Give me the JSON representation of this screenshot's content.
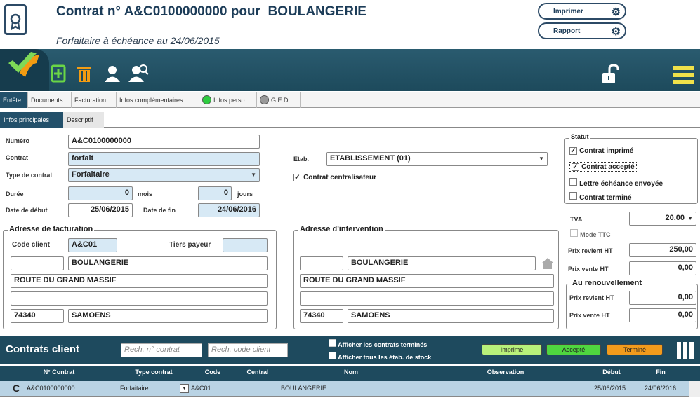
{
  "header": {
    "title_prefix": "Contrat n° A&C0100000000  pour",
    "title_client": "BOULANGERIE",
    "subtitle": "Forfaitaire à échéance au 24/06/2015",
    "print_label": "Imprimer",
    "report_label": "Rapport"
  },
  "tabs": [
    "Entête",
    "Documents",
    "Facturation",
    "Infos complémentaires",
    "Infos perso",
    "G.E.D."
  ],
  "subtabs": [
    "Infos principales",
    "Descriptif"
  ],
  "form": {
    "numero_label": "Numéro",
    "numero": "A&C0100000000",
    "contrat_label": "Contrat",
    "contrat": "forfait",
    "type_label": "Type de contrat",
    "type": "Forfaitaire",
    "duree_label": "Durée",
    "duree_mois": "0",
    "mois_label": "mois",
    "duree_jours": "0",
    "jours_label": "jours",
    "debut_label": "Date de début",
    "debut": "25/06/2015",
    "fin_label": "Date de fin",
    "fin": "24/06/2016",
    "etab_label": "Etab.",
    "etab": "ETABLISSEMENT (01)",
    "centralisateur_label": "Contrat centralisateur"
  },
  "statut": {
    "title": "Statut",
    "items": [
      {
        "label": "Contrat imprimé",
        "checked": "✓"
      },
      {
        "label": "Contrat accepté",
        "checked": "✓"
      },
      {
        "label": "Lettre échéance envoyée",
        "checked": ""
      },
      {
        "label": "Contrat terminé",
        "checked": ""
      }
    ]
  },
  "tarif": {
    "tva_label": "TVA",
    "tva": "20,00",
    "ttc_label": "Mode TTC",
    "prix_revient_label": "Prix revient HT",
    "prix_revient": "250,00",
    "prix_vente_label": "Prix vente HT",
    "prix_vente": "0,00",
    "renouv_title": "Au renouvellement",
    "renouv_revient_label": "Prix revient HT",
    "renouv_revient": "0,00",
    "renouv_vente_label": "Prix vente HT",
    "renouv_vente": "0,00"
  },
  "facturation": {
    "title": "Adresse de facturation",
    "code_label": "Code client",
    "code": "A&C01",
    "tiers_label": "Tiers payeur",
    "nom": "BOULANGERIE",
    "adresse": "ROUTE DU GRAND MASSIF",
    "cp": "74340",
    "ville": "SAMOENS"
  },
  "intervention": {
    "title": "Adresse d'intervention",
    "nom": "BOULANGERIE",
    "adresse": "ROUTE DU GRAND MASSIF",
    "cp": "74340",
    "ville": "SAMOENS"
  },
  "list": {
    "title": "Contrats client",
    "search_contrat": "Rech. n° contrat",
    "search_code": "Rech. code client",
    "opt1": "Afficher les contrats terminés",
    "opt2": "Afficher tous les étab. de stock",
    "pill_imprime": "Imprimé",
    "pill_accepte": "Accepté",
    "pill_termine": "Terminé",
    "colors": {
      "imprime": "#b8f07a",
      "accepte": "#4fd63f",
      "termine": "#f29b1c"
    },
    "columns": [
      "N° Contrat",
      "Type contrat",
      "Code",
      "Central",
      "Nom",
      "Observation",
      "Début",
      "Fin"
    ],
    "rows": [
      {
        "num": "A&C0100000000",
        "type": "Forfaitaire",
        "code": "A&C01",
        "central": "",
        "nom": "BOULANGERIE",
        "obs": "",
        "debut": "25/06/2015",
        "fin": "24/06/2016"
      }
    ]
  }
}
